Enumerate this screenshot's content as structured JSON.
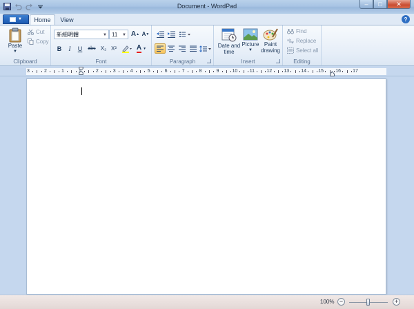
{
  "window": {
    "title": "Document - WordPad",
    "controls": {
      "minimize": "–",
      "maximize": "□",
      "close": "✕"
    }
  },
  "quick_access": [
    "save-icon",
    "undo-icon",
    "redo-icon",
    "customize-icon"
  ],
  "tabs": [
    {
      "label": "Home",
      "active": true
    },
    {
      "label": "View",
      "active": false
    }
  ],
  "help": "?",
  "ribbon": {
    "clipboard": {
      "label": "Clipboard",
      "paste": "Paste",
      "cut": "Cut",
      "copy": "Copy"
    },
    "font": {
      "label": "Font",
      "family": "新細明體",
      "size": "11",
      "grow": "A",
      "shrink": "A",
      "bold": "B",
      "italic": "I",
      "underline": "U",
      "strike": "abc",
      "subscript": "X₂",
      "superscript": "X²",
      "color": "A"
    },
    "paragraph": {
      "label": "Paragraph"
    },
    "insert": {
      "label": "Insert",
      "datetime_line1": "Date and",
      "datetime_line2": "time",
      "picture": "Picture",
      "paint_line1": "Paint",
      "paint_line2": "drawing"
    },
    "editing": {
      "label": "Editing",
      "find": "Find",
      "replace": "Replace",
      "select_all": "Select all"
    }
  },
  "ruler": {
    "ticks": [
      "3",
      "2",
      "1",
      "1",
      "2",
      "3",
      "4",
      "5",
      "6",
      "7",
      "8",
      "9",
      "10",
      "11",
      "12",
      "13",
      "14",
      "15",
      "16",
      "17"
    ]
  },
  "status": {
    "zoom": "100%",
    "zoom_out": "−",
    "zoom_in": "+",
    "zoom_level": 1.0
  },
  "colors": {
    "accent": "#1c5ab2",
    "ribbon_bg": "#e6eef8",
    "workspace": "#c5d7ee",
    "highlight": "#f8c35a"
  }
}
